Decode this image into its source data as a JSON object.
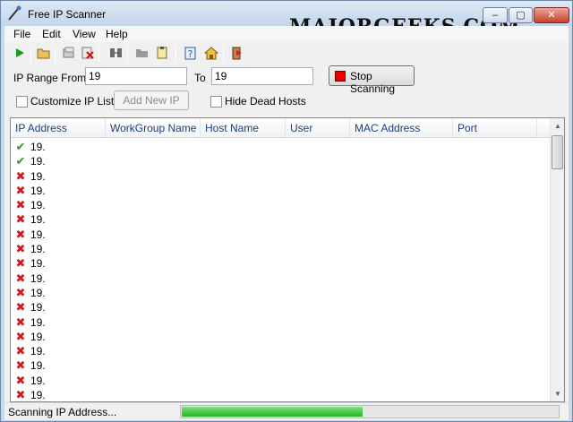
{
  "window": {
    "title": "Free IP Scanner",
    "watermark": "MAJORGEEKS.COM",
    "controls": {
      "minimize": "–",
      "maximize": "▢",
      "close": "✕"
    }
  },
  "menu": [
    "File",
    "Edit",
    "View",
    "Help"
  ],
  "toolbar": {
    "icons": [
      "play-icon",
      "open-folder-icon",
      "export-icon",
      "delete-icon",
      "network-icon",
      "folder-icon",
      "clipboard-icon",
      "help-icon",
      "home-icon",
      "exit-icon"
    ]
  },
  "range": {
    "from_label": "IP Range From",
    "from_value": "19",
    "to_label": "To",
    "to_value": "19",
    "stop_label": "Stop Scanning"
  },
  "options": {
    "customize_label": "Customize IP List",
    "add_new_ip_label": "Add New IP",
    "hide_dead_label": "Hide Dead Hosts"
  },
  "list": {
    "columns": [
      "IP Address",
      "WorkGroup Name",
      "Host Name",
      "User",
      "MAC Address",
      "Port"
    ],
    "rows": [
      {
        "status": "alive",
        "ip": "19."
      },
      {
        "status": "alive",
        "ip": "19."
      },
      {
        "status": "dead",
        "ip": "19."
      },
      {
        "status": "dead",
        "ip": "19."
      },
      {
        "status": "dead",
        "ip": "19."
      },
      {
        "status": "dead",
        "ip": "19."
      },
      {
        "status": "dead",
        "ip": "19."
      },
      {
        "status": "dead",
        "ip": "19."
      },
      {
        "status": "dead",
        "ip": "19."
      },
      {
        "status": "dead",
        "ip": "19."
      },
      {
        "status": "dead",
        "ip": "19."
      },
      {
        "status": "dead",
        "ip": "19."
      },
      {
        "status": "dead",
        "ip": "19."
      },
      {
        "status": "dead",
        "ip": "19."
      },
      {
        "status": "dead",
        "ip": "19."
      },
      {
        "status": "dead",
        "ip": "19."
      },
      {
        "status": "dead",
        "ip": "19."
      },
      {
        "status": "dead",
        "ip": "19."
      }
    ]
  },
  "status": {
    "text": "Scanning IP Address...",
    "progress": 0.48
  },
  "colors": {
    "alive": "#2c9a2c",
    "dead": "#d11a1a",
    "stop": "#e60000",
    "progress": "#1fb81f"
  }
}
